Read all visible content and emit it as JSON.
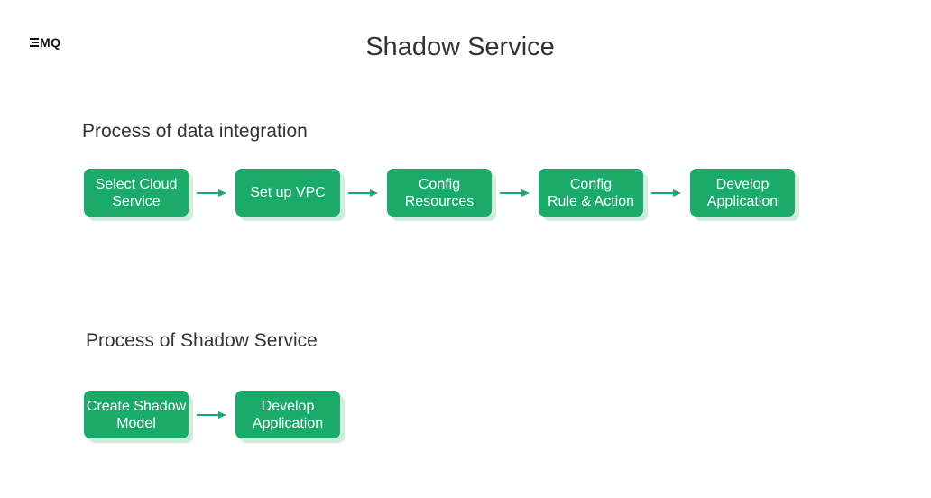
{
  "logo": {
    "text": "MQ",
    "icon": "emq-logo-icon"
  },
  "title": "Shadow Service",
  "sections": [
    {
      "heading": "Process of data integration",
      "steps": [
        "Select Cloud\nService",
        "Set up VPC",
        "Config\nResources",
        "Config\nRule &  Action",
        "Develop\nApplication"
      ]
    },
    {
      "heading": "Process of Shadow Service",
      "steps": [
        "Create Shadow\nModel",
        "Develop\nApplication"
      ]
    }
  ],
  "colors": {
    "box_fill": "#1aaa6a",
    "box_shadow": "#cdeedd",
    "arrow": "#1aaa6a",
    "text": "#333333"
  }
}
